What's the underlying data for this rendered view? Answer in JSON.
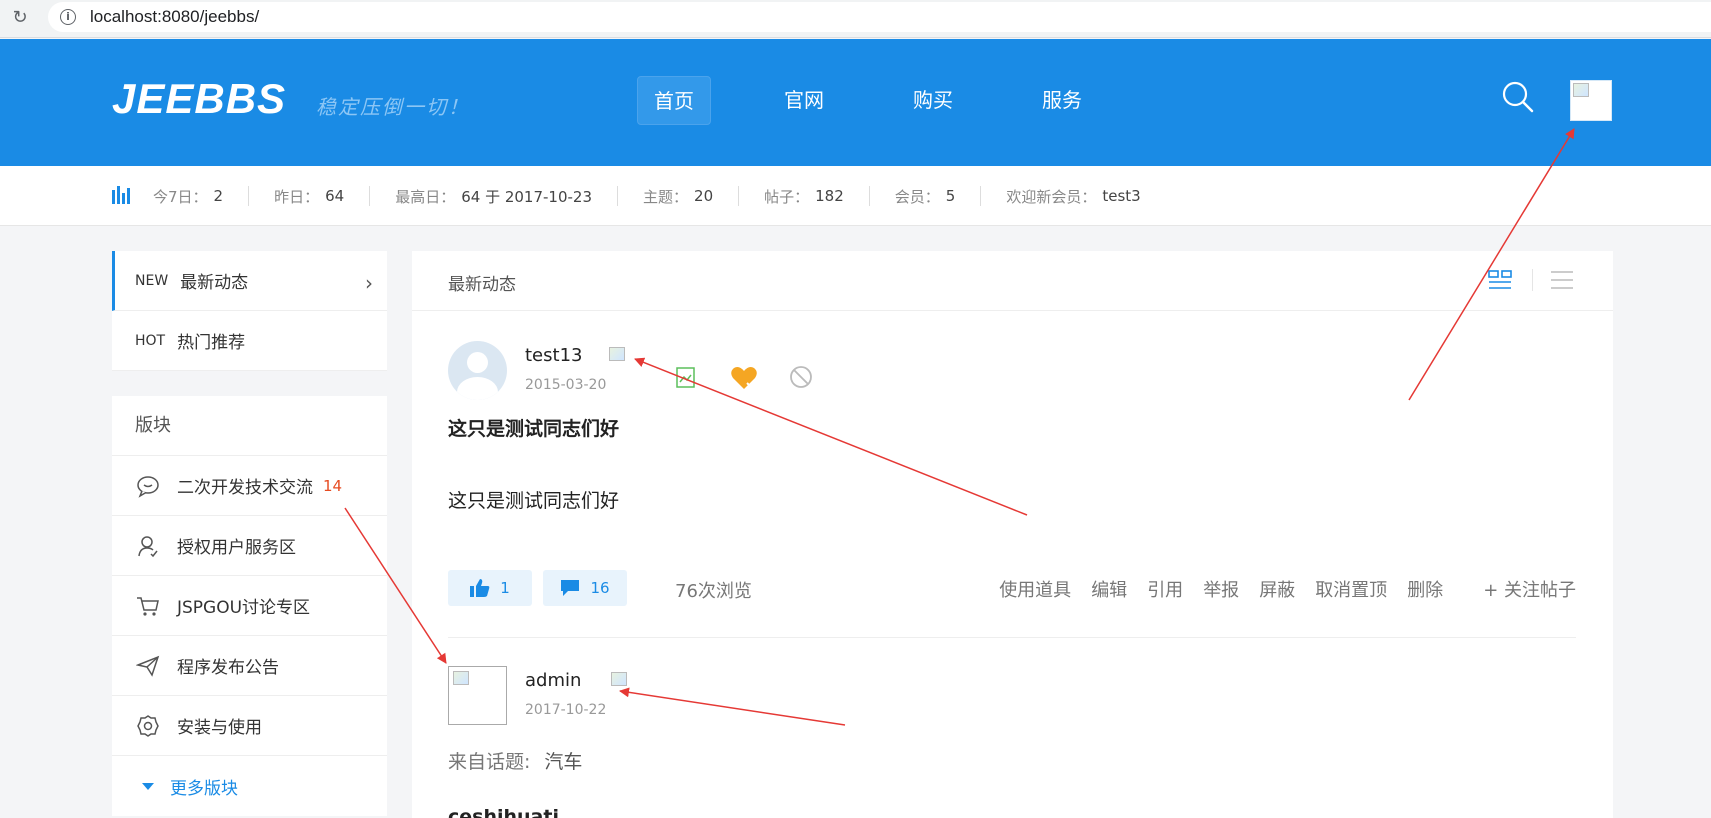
{
  "browser": {
    "url": "localhost:8080/jeebbs/"
  },
  "header": {
    "logo": "JEEBBS",
    "slogan": "稳定压倒一切！",
    "nav": [
      {
        "label": "首页",
        "active": true
      },
      {
        "label": "官网",
        "active": false
      },
      {
        "label": "购买",
        "active": false
      },
      {
        "label": "服务",
        "active": false
      }
    ]
  },
  "stats": [
    {
      "label": "今7日：",
      "value": "2"
    },
    {
      "label": "昨日：",
      "value": "64"
    },
    {
      "label": "最高日：",
      "value": "64 于 2017-10-23"
    },
    {
      "label": "主题：",
      "value": "20"
    },
    {
      "label": "帖子：",
      "value": "182"
    },
    {
      "label": "会员：",
      "value": "5"
    },
    {
      "label": "欢迎新会员：",
      "value": "test3"
    }
  ],
  "sidebar": {
    "feeds": [
      {
        "tag": "NEW",
        "label": "最新动态"
      },
      {
        "tag": "HOT",
        "label": "热门推荐"
      }
    ],
    "boards_title": "版块",
    "boards": [
      {
        "label": "二次开发技术交流",
        "count": "14",
        "icon": "chat-icon"
      },
      {
        "label": "授权用户服务区",
        "count": "",
        "icon": "user-icon"
      },
      {
        "label": "JSPGOU讨论专区",
        "count": "",
        "icon": "cart-icon"
      },
      {
        "label": "程序发布公告",
        "count": "",
        "icon": "send-icon"
      },
      {
        "label": "安装与使用",
        "count": "",
        "icon": "gear-icon"
      }
    ],
    "more": "更多版块"
  },
  "main": {
    "title": "最新动态",
    "posts": [
      {
        "author": "test13",
        "date": "2015-03-20",
        "title": "这只是测试同志们好",
        "body": "这只是测试同志们好",
        "likes": "1",
        "comments": "16",
        "views": "76次浏览",
        "ops": [
          "使用道具",
          "编辑",
          "引用",
          "举报",
          "屏蔽",
          "取消置顶",
          "删除"
        ],
        "follow": "+ 关注帖子"
      },
      {
        "author": "admin",
        "date": "2017-10-22",
        "from_label": "来自话题:",
        "topic": "汽车",
        "title": "ceshihuati"
      }
    ]
  },
  "colors": {
    "brand": "#1a8be5",
    "count": "#e64b21",
    "arrow": "#e53935"
  }
}
